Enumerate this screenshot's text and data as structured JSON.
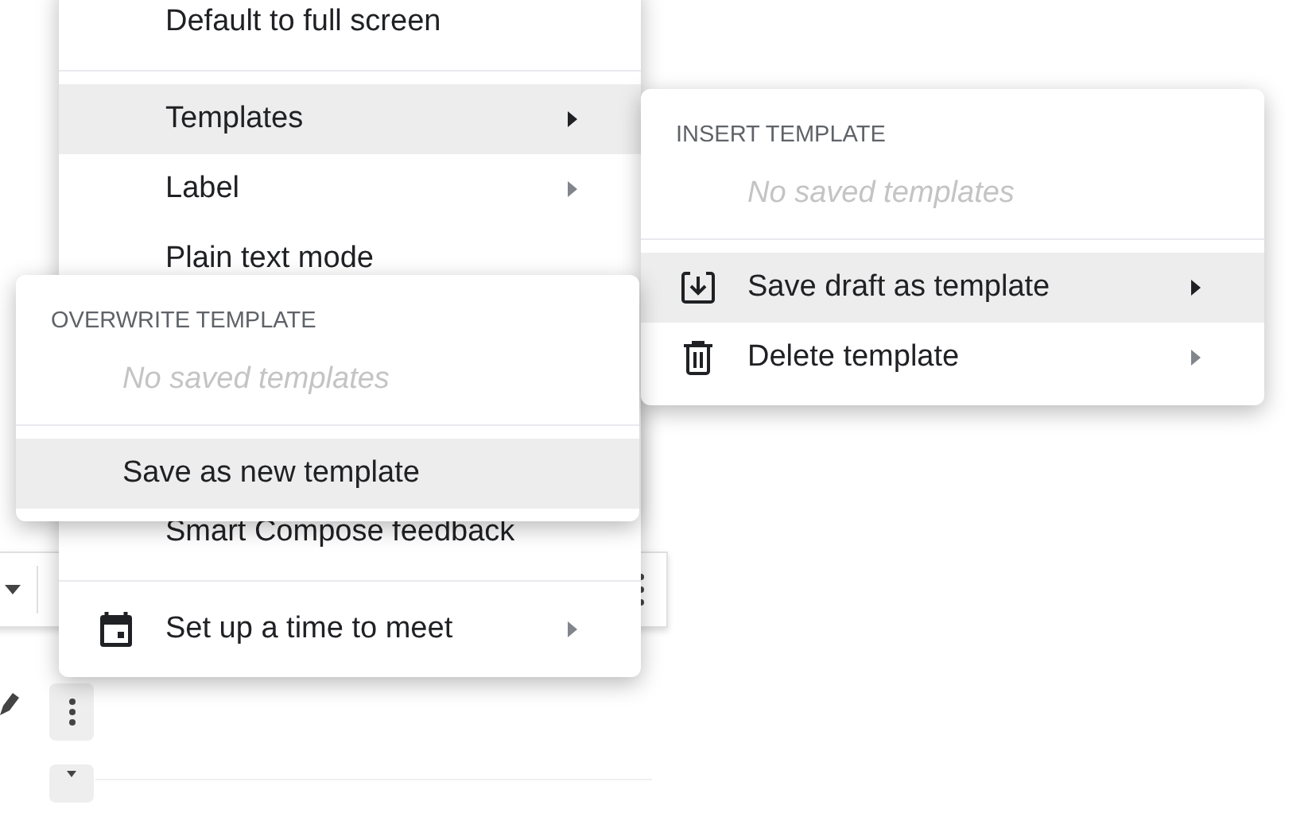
{
  "main_menu": {
    "upper_items": [
      {
        "kind": "item",
        "label": "Default to full screen",
        "selected": false,
        "submenu": false
      },
      {
        "kind": "divider"
      },
      {
        "kind": "item",
        "label": "Templates",
        "selected": true,
        "submenu": true
      },
      {
        "kind": "item",
        "label": "Label",
        "selected": false,
        "submenu": true
      },
      {
        "kind": "item",
        "label": "Plain text mode",
        "selected": false,
        "submenu": false
      }
    ],
    "lower_items": [
      {
        "kind": "item",
        "label": "Smart Compose feedback",
        "selected": false,
        "submenu": false
      },
      {
        "kind": "divider"
      },
      {
        "kind": "calendar",
        "label": "Set up a time to meet",
        "selected": false,
        "submenu": true
      }
    ]
  },
  "insert_template_menu": {
    "heading": "INSERT TEMPLATE",
    "empty_text": "No saved templates",
    "items": [
      {
        "kind": "save",
        "label": "Save draft as template",
        "selected": true,
        "submenu": true
      },
      {
        "kind": "delete",
        "label": "Delete template",
        "selected": false,
        "submenu": true
      }
    ]
  },
  "overwrite_template_menu": {
    "heading": "OVERWRITE TEMPLATE",
    "empty_text": "No saved templates",
    "items": [
      {
        "kind": "item",
        "label": "Save as new template",
        "selected": true,
        "submenu": false
      }
    ]
  }
}
